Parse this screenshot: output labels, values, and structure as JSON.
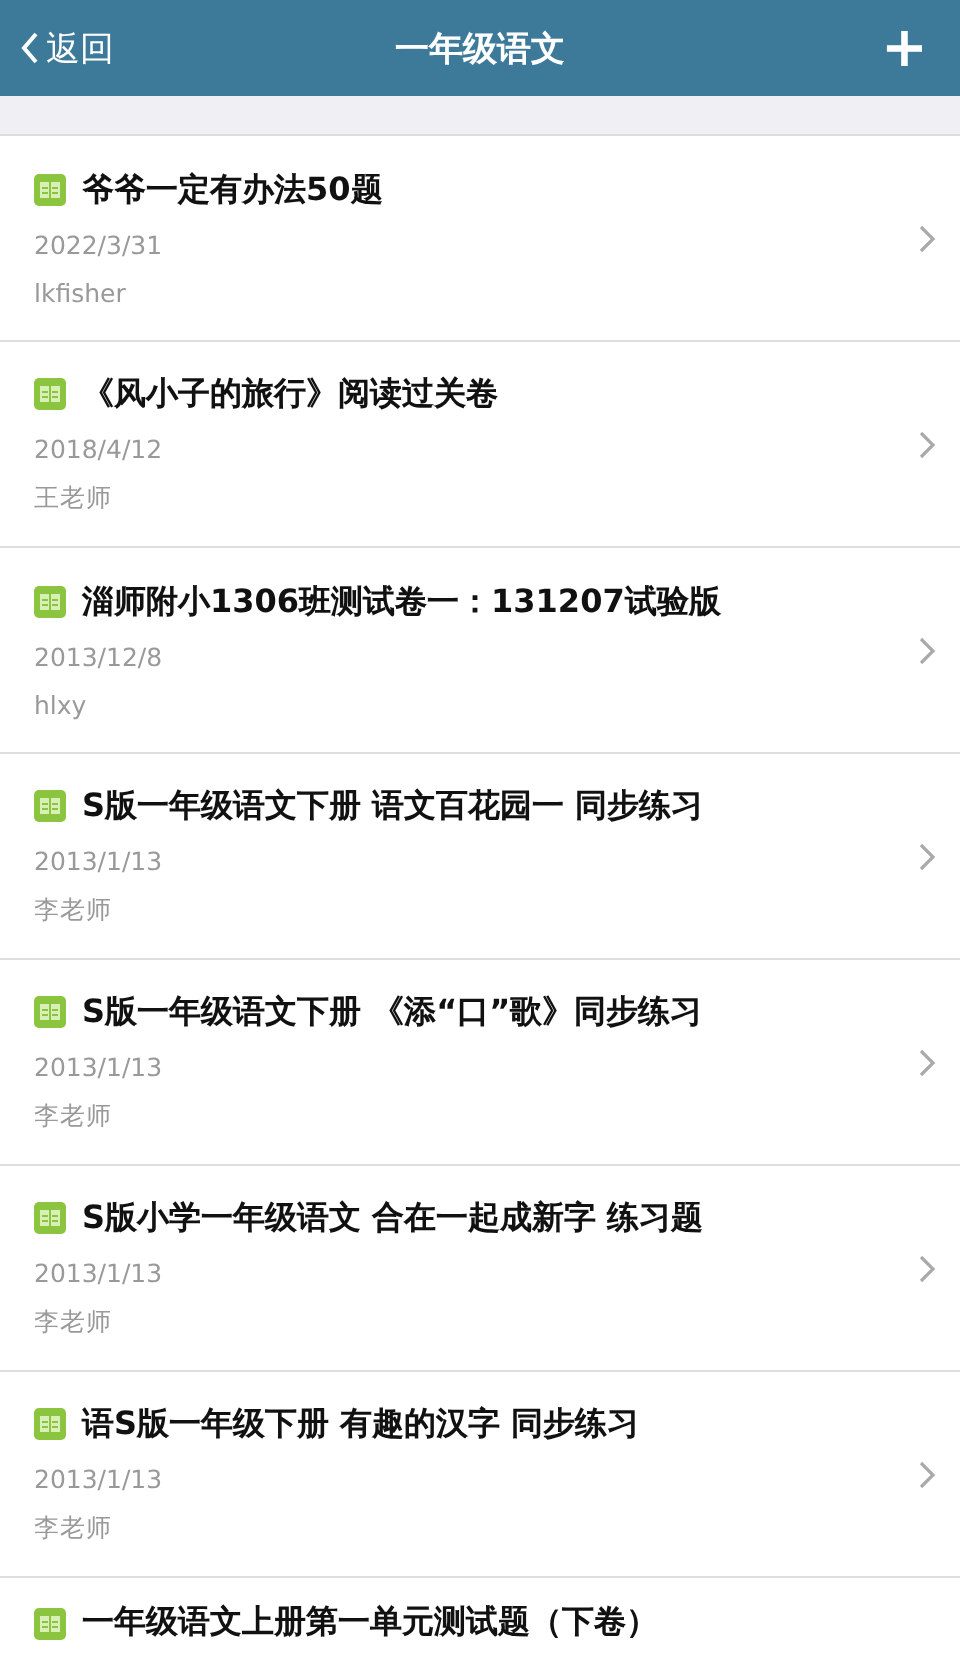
{
  "header": {
    "back": "返回",
    "title": "一年级语文",
    "add": "+"
  },
  "items": [
    {
      "title": "爷爷一定有办法50题",
      "date": "2022/3/31",
      "author": "lkfisher"
    },
    {
      "title": "《风小子的旅行》阅读过关卷",
      "date": "2018/4/12",
      "author": "王老师"
    },
    {
      "title": "淄师附小1306班测试卷一：131207试验版",
      "date": "2013/12/8",
      "author": "hlxy"
    },
    {
      "title": "S版一年级语文下册 语文百花园一 同步练习",
      "date": "2013/1/13",
      "author": "李老师"
    },
    {
      "title": "S版一年级语文下册 《添“口”歌》同步练习",
      "date": "2013/1/13",
      "author": "李老师"
    },
    {
      "title": "S版小学一年级语文 合在一起成新字 练习题",
      "date": "2013/1/13",
      "author": "李老师"
    },
    {
      "title": "语S版一年级下册 有趣的汉字 同步练习",
      "date": "2013/1/13",
      "author": "李老师"
    },
    {
      "title": "一年级语文上册第一单元测试题（下卷）"
    }
  ]
}
